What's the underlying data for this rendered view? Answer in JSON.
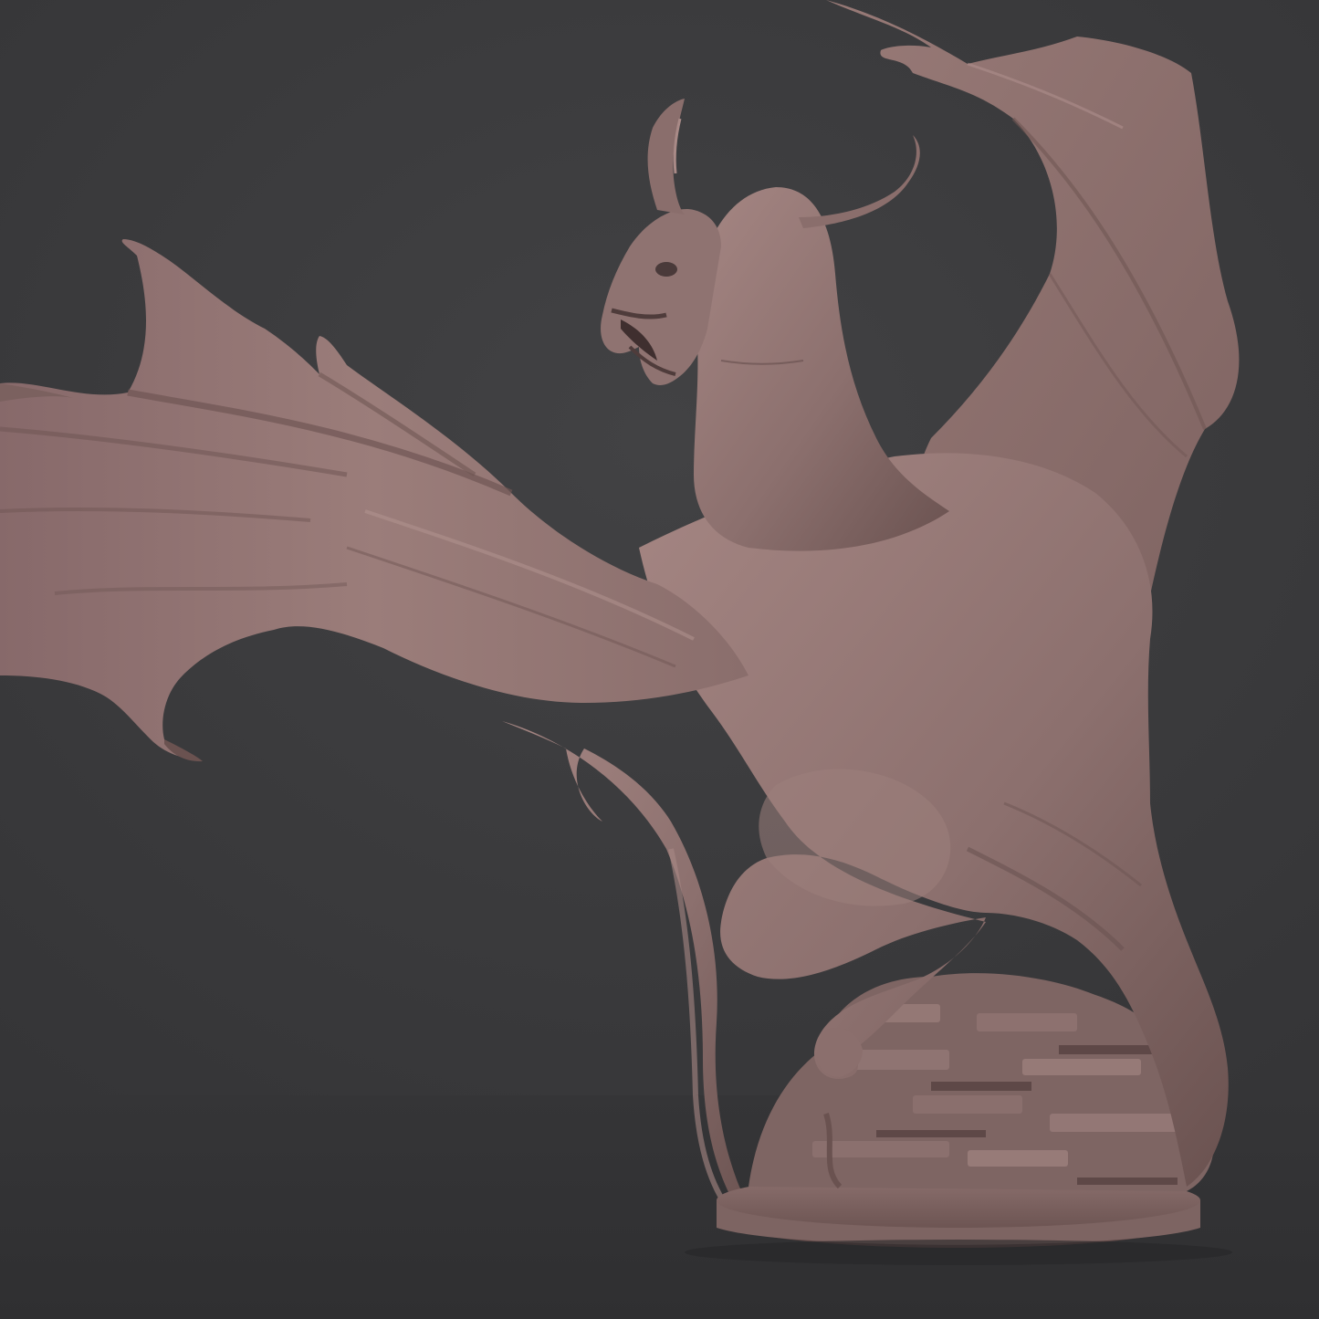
{
  "scene": {
    "subject": "dragon-sculpture",
    "colors": {
      "backdrop": "#3a3a3c",
      "floor": "#333335",
      "clay": "#8c706e",
      "clay_light": "#a58683",
      "clay_dark": "#5e4847",
      "clay_shadow": "#4a3a3a"
    }
  }
}
